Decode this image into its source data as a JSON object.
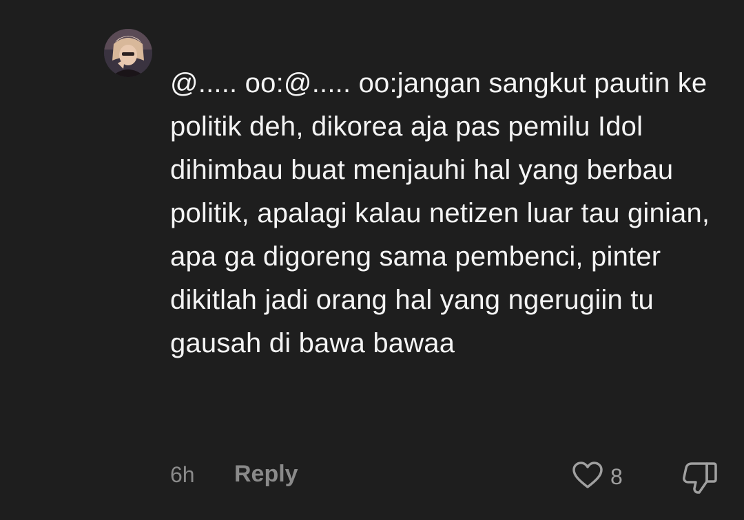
{
  "comment": {
    "text": "@..... oo:@..... oo:jangan sangkut pautin ke politik deh, dikorea aja pas pemilu Idol dihimbau buat menjauhi hal yang berbau politik, apalagi kalau netizen luar tau ginian, apa ga digoreng sama pembenci, pinter dikitlah jadi orang hal yang ngerugiin tu gausah di bawa bawaa",
    "timestamp": "6h",
    "reply_label": "Reply",
    "like_count": "8"
  },
  "icons": {
    "like": "heart-outline-icon",
    "dislike": "thumbs-down-outline-icon"
  },
  "colors": {
    "background": "#1e1e1e",
    "text": "#f4f4f4",
    "muted": "#8a8a8a"
  }
}
